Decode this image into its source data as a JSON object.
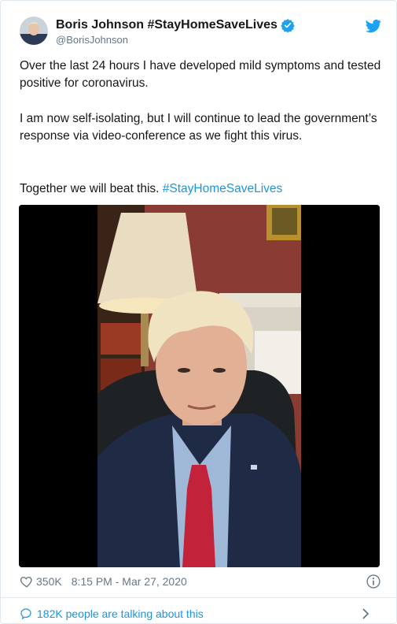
{
  "author": {
    "display_name": "Boris Johnson #StayHomeSaveLives",
    "handle": "@BorisJohnson",
    "verified": true
  },
  "tweet": {
    "paragraph_1": "Over the last 24 hours I have developed mild symptoms and tested positive for coronavirus.",
    "paragraph_2": "I am now self-isolating, but I will continue to lead the government’s response via video-conference as we fight this virus.",
    "paragraph_3_text": "Together we will beat this. ",
    "paragraph_3_hashtag": "#StayHomeSaveLives"
  },
  "media": {
    "type": "video"
  },
  "footer": {
    "likes": "350K",
    "timestamp": "8:15 PM - Mar 27, 2020"
  },
  "conversation": {
    "label": "182K people are talking about this"
  },
  "colors": {
    "text": "#14171a",
    "secondary": "#657786",
    "link": "#1b95e0",
    "verified": "#1da1f2",
    "border": "#e1e8ed"
  },
  "icons": [
    "twitter-bird-icon",
    "verified-badge-icon",
    "heart-icon",
    "info-icon",
    "speech-bubble-icon",
    "chevron-right-icon"
  ]
}
